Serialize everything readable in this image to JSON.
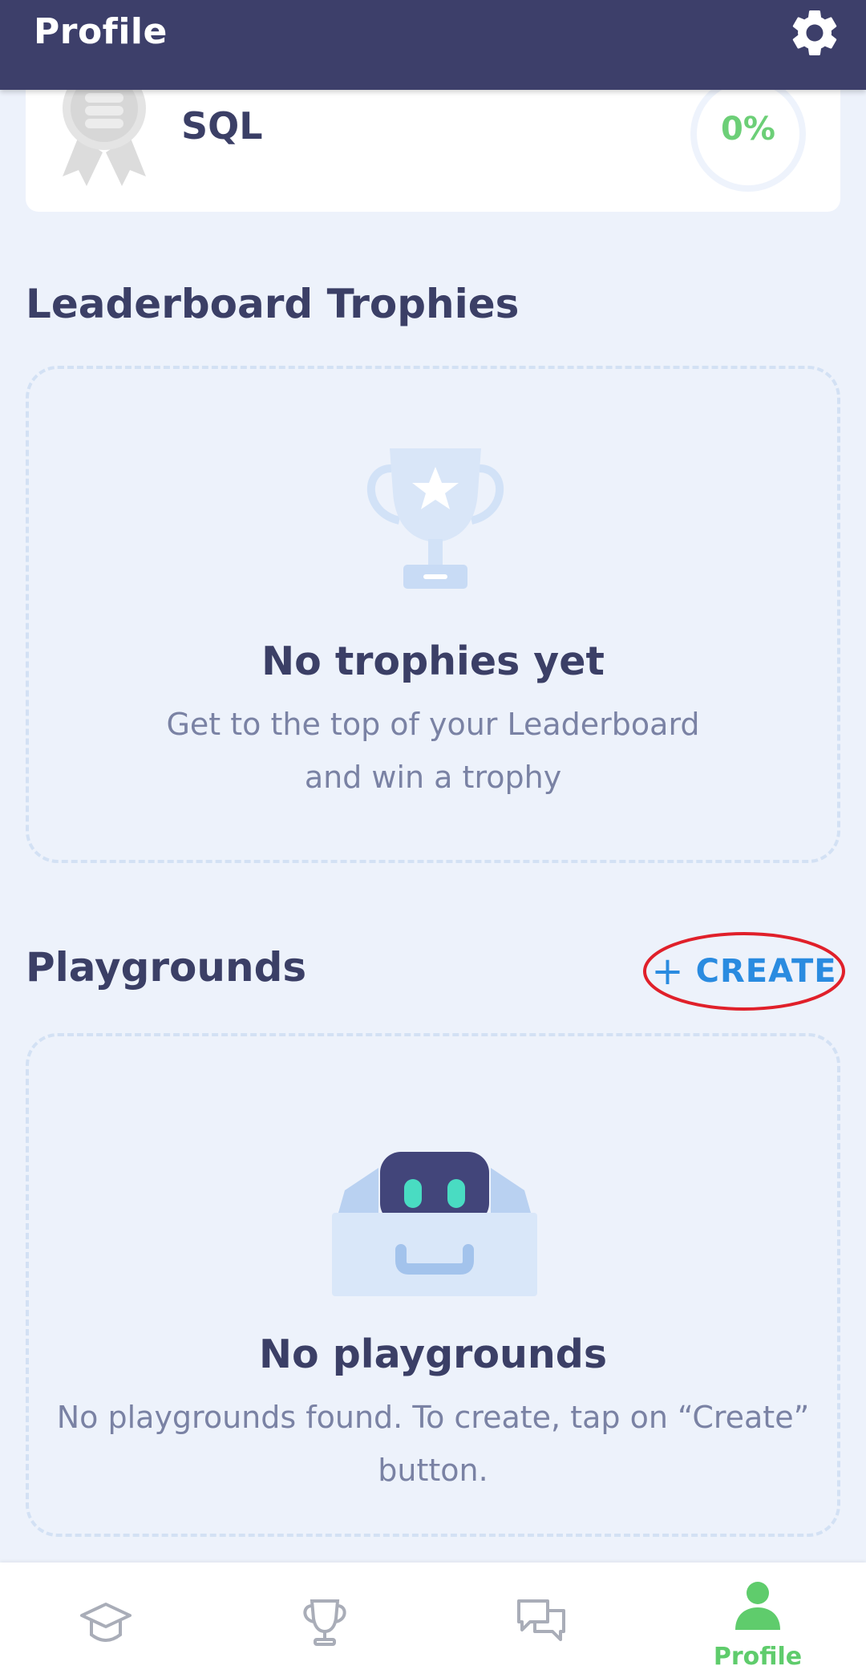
{
  "header": {
    "title": "Profile",
    "settings_icon": "gear-icon"
  },
  "course": {
    "name": "SQL",
    "progress_label": "0%",
    "progress": 0
  },
  "trophies": {
    "section_title": "Leaderboard Trophies",
    "empty_title": "No trophies yet",
    "empty_text": "Get to the top of your Leaderboard and win a trophy"
  },
  "playgrounds": {
    "section_title": "Playgrounds",
    "create_label": "CREATE",
    "empty_title": "No playgrounds",
    "empty_text": "No playgrounds found. To create, tap on “Create” button."
  },
  "bottom_nav": {
    "items": [
      {
        "icon": "graduation-cap-icon",
        "label": ""
      },
      {
        "icon": "trophy-icon",
        "label": ""
      },
      {
        "icon": "chat-bubbles-icon",
        "label": ""
      },
      {
        "icon": "person-icon",
        "label": "Profile",
        "active": true
      }
    ]
  },
  "colors": {
    "header_bg": "#3d3f6a",
    "page_bg": "#edf2fb",
    "accent_green": "#6ccf77",
    "accent_blue": "#2a8be0",
    "annotation_red": "#e0202a"
  }
}
